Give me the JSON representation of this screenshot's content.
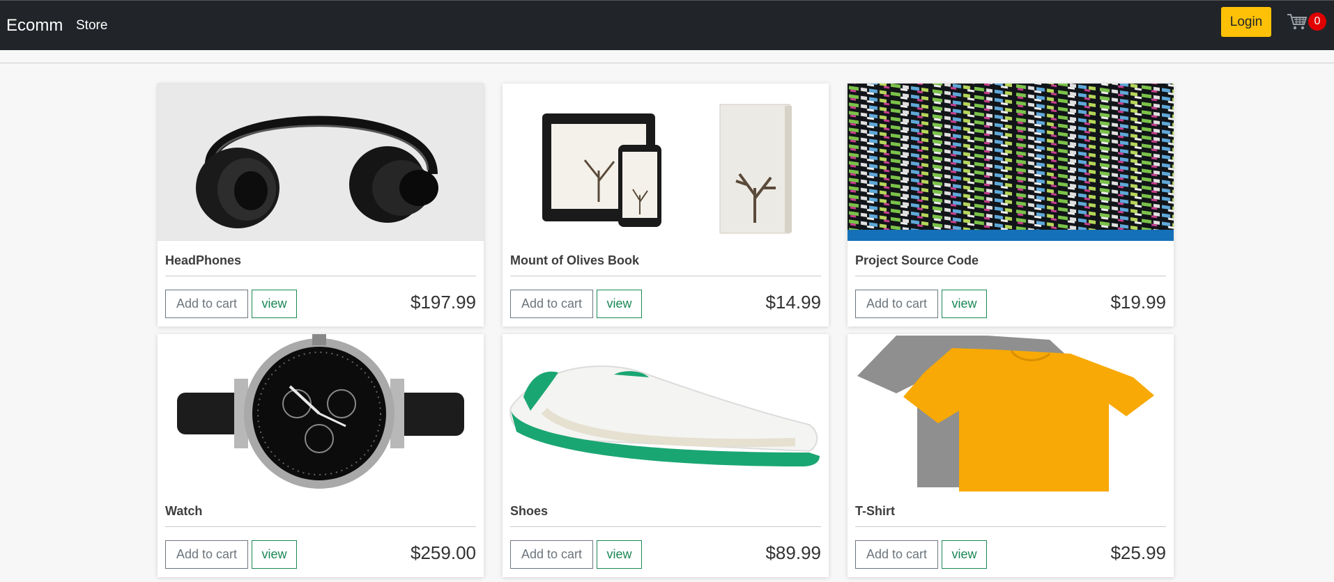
{
  "navbar": {
    "brand": "Ecomm",
    "store_link": "Store",
    "login_label": "Login",
    "cart_icon": "cart-icon",
    "cart_count": "0",
    "colors": {
      "bg": "#212529",
      "login": "#ffc107",
      "badge": "#e00000"
    }
  },
  "buttons": {
    "add_to_cart": "Add to cart",
    "view": "view"
  },
  "products": [
    {
      "name": "HeadPhones",
      "price": "$197.99",
      "image": "headphones"
    },
    {
      "name": "Mount of Olives Book",
      "price": "$14.99",
      "image": "book-on-devices"
    },
    {
      "name": "Project Source Code",
      "price": "$19.99",
      "image": "code-screen"
    },
    {
      "name": "Watch",
      "price": "$259.00",
      "image": "wristwatch"
    },
    {
      "name": "Shoes",
      "price": "$89.99",
      "image": "sneaker"
    },
    {
      "name": "T-Shirt",
      "price": "$25.99",
      "image": "t-shirts"
    }
  ]
}
